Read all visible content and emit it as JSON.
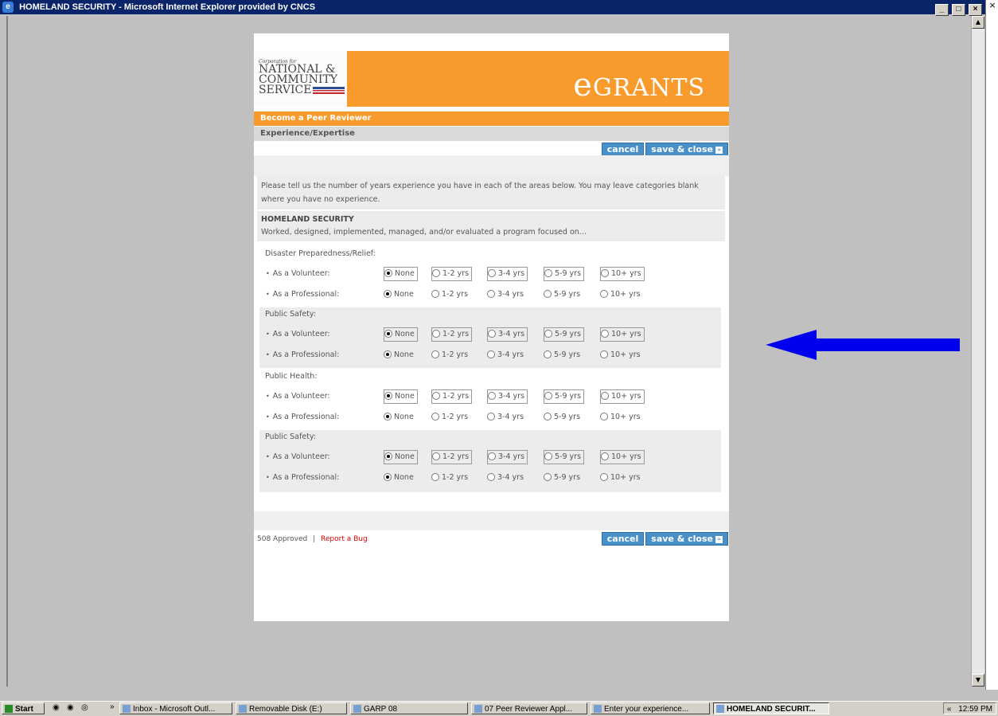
{
  "window": {
    "title": "HOMELAND SECURITY - Microsoft Internet Explorer provided by CNCS",
    "controls": [
      "_",
      "□",
      "×"
    ]
  },
  "brand": {
    "corp_line": "Corporation for",
    "name_lines": [
      "NATIONAL &",
      "COMMUNITY",
      "SERVICE"
    ],
    "app_name": "eGrants",
    "orange": "#f89a2c",
    "blue": "#4a90c8"
  },
  "header": {
    "section": "Become a Peer Reviewer",
    "subsection": "Experience/Expertise"
  },
  "buttons": {
    "cancel": "cancel",
    "save_close": "save & close"
  },
  "intro": "Please tell us the number of years experience you have in each of the areas below. You may leave categories blank where you have no experience.",
  "category": {
    "title": "HOMELAND SECURITY",
    "desc": "Worked, designed, implemented, managed, and/or evaluated a program focused on..."
  },
  "row_labels": {
    "volunteer": "As a Volunteer:",
    "professional": "As a Professional:"
  },
  "options": [
    "None",
    "1-2 yrs",
    "3-4 yrs",
    "5-9 yrs",
    "10+ yrs"
  ],
  "groups": [
    {
      "title": "Disaster Preparedness/Relief:",
      "volunteer": "None",
      "professional": "None"
    },
    {
      "title": "Public Safety:",
      "volunteer": "None",
      "professional": "None"
    },
    {
      "title": "Public Health:",
      "volunteer": "None",
      "professional": "None"
    },
    {
      "title": "Public Safety:",
      "volunteer": "None",
      "professional": "None"
    }
  ],
  "footer": {
    "approved": "508 Approved",
    "separator": "|",
    "bug_link": "Report a Bug"
  },
  "taskbar": {
    "start": "Start",
    "chevron": "»",
    "items": [
      "Inbox - Microsoft Outl...",
      "Removable Disk (E:)",
      "GARP 08",
      "07 Peer Reviewer Appl...",
      "Enter your experience...",
      "HOMELAND SECURIT..."
    ],
    "active_index": 5,
    "tray_chevron": "«",
    "clock": "12:59 PM"
  }
}
